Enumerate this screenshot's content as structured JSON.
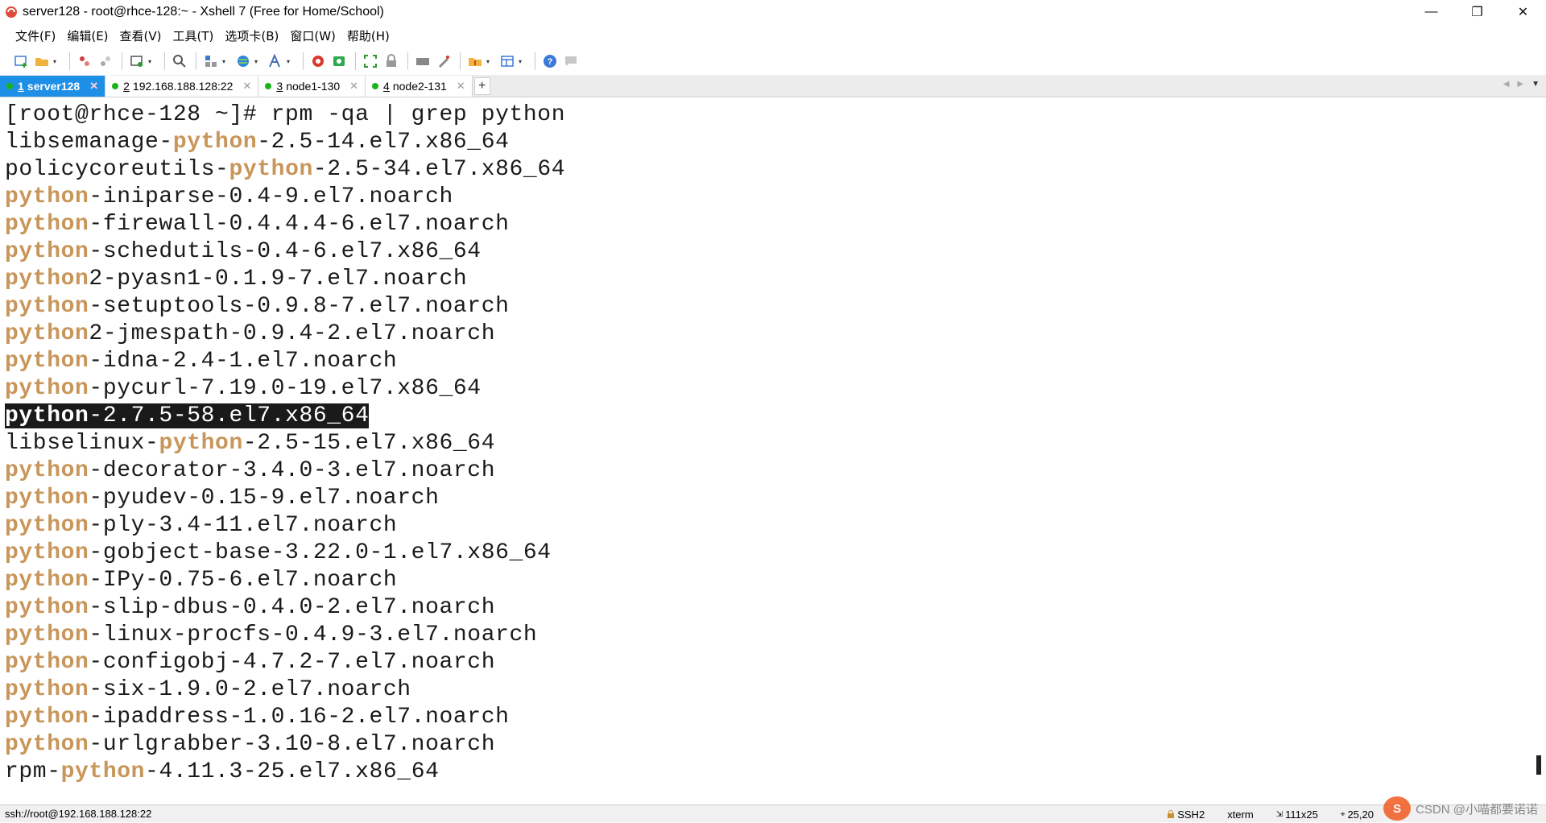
{
  "window": {
    "title": "server128 - root@rhce-128:~ - Xshell 7 (Free for Home/School)",
    "controls": [
      "—",
      "❐",
      "✕"
    ]
  },
  "menu": [
    "文件(F)",
    "编辑(E)",
    "查看(V)",
    "工具(T)",
    "选项卡(B)",
    "窗口(W)",
    "帮助(H)"
  ],
  "tabs": [
    {
      "num": "1",
      "label": "server128",
      "active": true
    },
    {
      "num": "2",
      "label": "192.168.188.128:22",
      "active": false
    },
    {
      "num": "3",
      "label": "node1-130",
      "active": false
    },
    {
      "num": "4",
      "label": "node2-131",
      "active": false
    }
  ],
  "tab_add": "+",
  "terminal": {
    "prompt": "[root@rhce-128 ~]# rpm -qa | grep python",
    "lines": [
      {
        "pre": "libsemanage-",
        "hl": "python",
        "post": "-2.5-14.el7.x86_64"
      },
      {
        "pre": "policycoreutils-",
        "hl": "python",
        "post": "-2.5-34.el7.x86_64"
      },
      {
        "pre": "",
        "hl": "python",
        "post": "-iniparse-0.4-9.el7.noarch"
      },
      {
        "pre": "",
        "hl": "python",
        "post": "-firewall-0.4.4.4-6.el7.noarch"
      },
      {
        "pre": "",
        "hl": "python",
        "post": "-schedutils-0.4-6.el7.x86_64"
      },
      {
        "pre": "",
        "hl": "python",
        "post": "2-pyasn1-0.1.9-7.el7.noarch"
      },
      {
        "pre": "",
        "hl": "python",
        "post": "-setuptools-0.9.8-7.el7.noarch"
      },
      {
        "pre": "",
        "hl": "python",
        "post": "2-jmespath-0.9.4-2.el7.noarch"
      },
      {
        "pre": "",
        "hl": "python",
        "post": "-idna-2.4-1.el7.noarch"
      },
      {
        "pre": "",
        "hl": "python",
        "post": "-pycurl-7.19.0-19.el7.x86_64"
      },
      {
        "pre": "",
        "hl": "python",
        "post": "-2.7.5-58.el7.x86_64",
        "selected": true
      },
      {
        "pre": "libselinux-",
        "hl": "python",
        "post": "-2.5-15.el7.x86_64"
      },
      {
        "pre": "",
        "hl": "python",
        "post": "-decorator-3.4.0-3.el7.noarch"
      },
      {
        "pre": "",
        "hl": "python",
        "post": "-pyudev-0.15-9.el7.noarch"
      },
      {
        "pre": "",
        "hl": "python",
        "post": "-ply-3.4-11.el7.noarch"
      },
      {
        "pre": "",
        "hl": "python",
        "post": "-gobject-base-3.22.0-1.el7.x86_64"
      },
      {
        "pre": "",
        "hl": "python",
        "post": "-IPy-0.75-6.el7.noarch"
      },
      {
        "pre": "",
        "hl": "python",
        "post": "-slip-dbus-0.4.0-2.el7.noarch"
      },
      {
        "pre": "",
        "hl": "python",
        "post": "-linux-procfs-0.4.9-3.el7.noarch"
      },
      {
        "pre": "",
        "hl": "python",
        "post": "-configobj-4.7.2-7.el7.noarch"
      },
      {
        "pre": "",
        "hl": "python",
        "post": "-six-1.9.0-2.el7.noarch"
      },
      {
        "pre": "",
        "hl": "python",
        "post": "-ipaddress-1.0.16-2.el7.noarch"
      },
      {
        "pre": "",
        "hl": "python",
        "post": "-urlgrabber-3.10-8.el7.noarch"
      },
      {
        "pre": "rpm-",
        "hl": "python",
        "post": "-4.11.3-25.el7.x86_64"
      }
    ]
  },
  "status": {
    "connection": "ssh://root@192.168.188.128:22",
    "protocol": "SSH2",
    "term": "xterm",
    "size": "111x25",
    "cursor": "25,20"
  },
  "watermark": {
    "logo": "S",
    "text": "CSDN @小喵都要诺诺"
  },
  "colors": {
    "accent": "#1e8fe6",
    "highlight": "#c8965a",
    "tab_dot": "#1ab31a"
  }
}
